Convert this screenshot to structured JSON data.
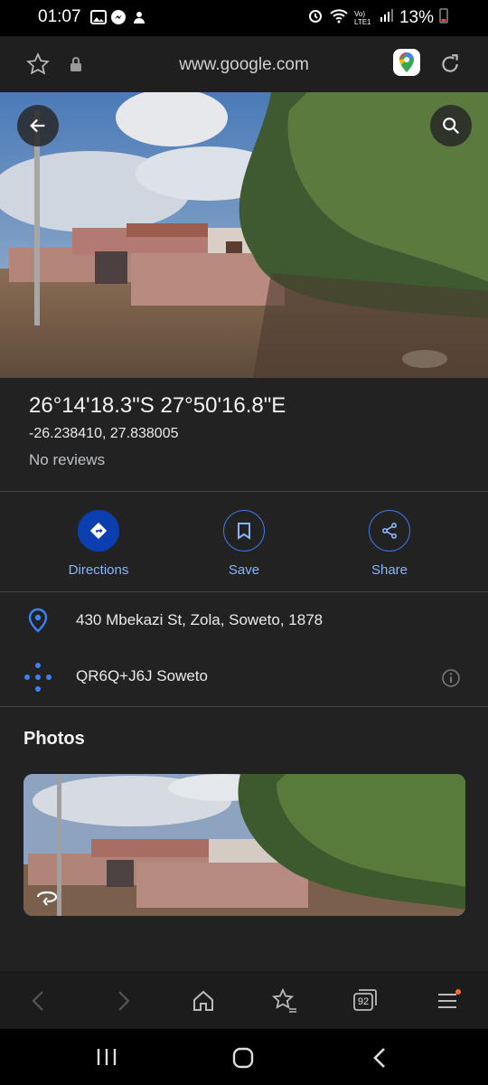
{
  "status_bar": {
    "time": "01:07",
    "battery": "13%",
    "network_label": "Vo) LTE1"
  },
  "browser": {
    "url": "www.google.com"
  },
  "place": {
    "title": "26°14'18.3\"S 27°50'16.8\"E",
    "coords": "-26.238410, 27.838005",
    "reviews": "No reviews"
  },
  "actions": {
    "directions": "Directions",
    "save": "Save",
    "share": "Share"
  },
  "details": {
    "address": "430 Mbekazi St, Zola, Soweto, 1878",
    "plus_code": "QR6Q+J6J Soweto"
  },
  "photos": {
    "title": "Photos"
  },
  "toolbar": {
    "tabs_count": "92"
  },
  "colors": {
    "accent": "#8ab4f8",
    "directions_fill": "#0b3fb0",
    "background": "#222222"
  }
}
